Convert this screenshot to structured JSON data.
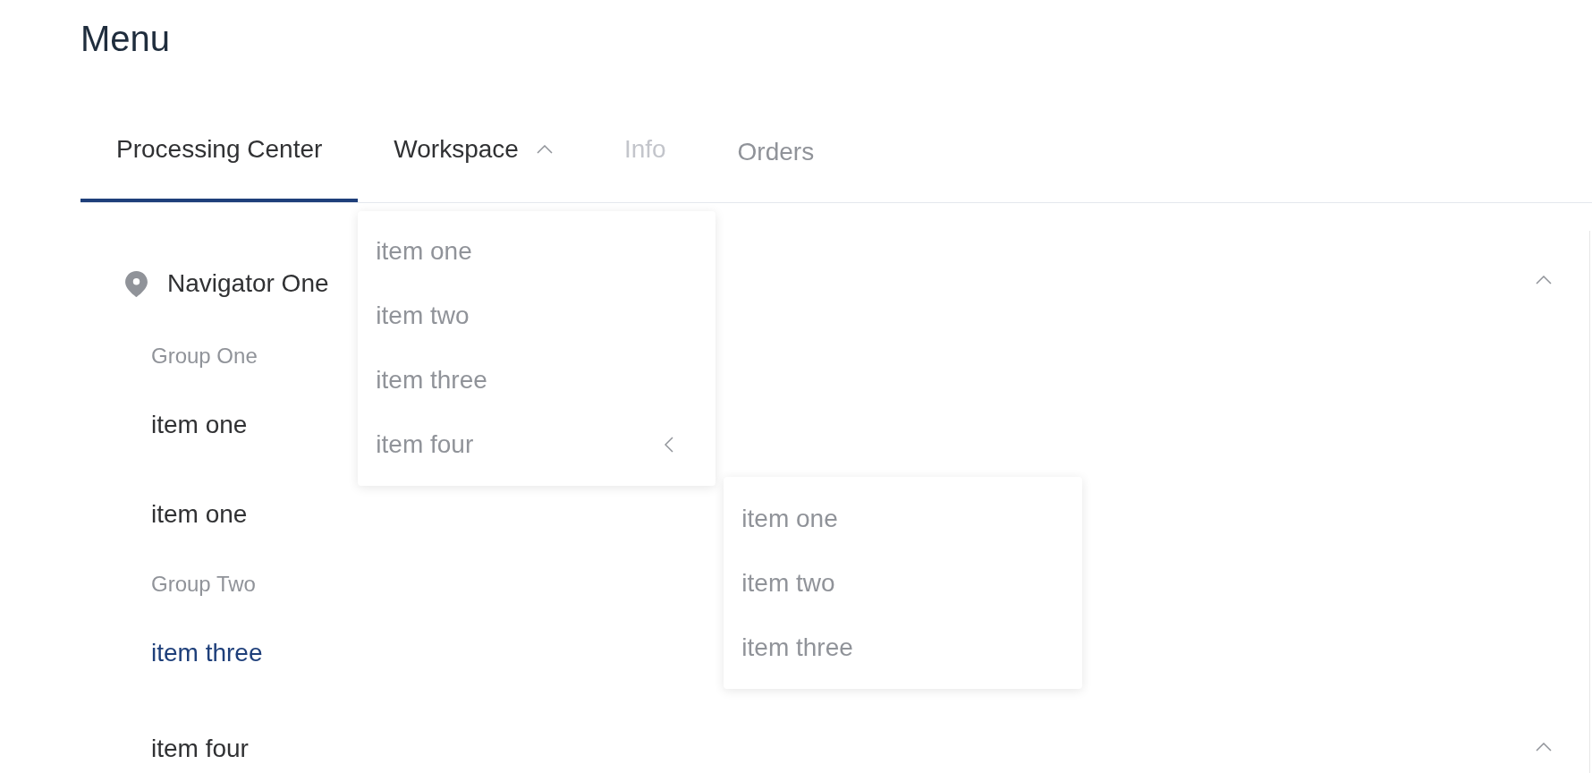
{
  "title": "Menu",
  "tabs": [
    {
      "kind": "item",
      "label": "Processing Center",
      "selected": true,
      "disabled": false
    },
    {
      "kind": "submenu",
      "label": "Workspace",
      "selected": false,
      "disabled": false,
      "expanded": true,
      "children": [
        {
          "kind": "item",
          "label": "item one",
          "selected": false
        },
        {
          "kind": "item",
          "label": "item two",
          "selected": false
        },
        {
          "kind": "item",
          "label": "item three",
          "selected": false
        },
        {
          "kind": "submenu",
          "label": "item four",
          "selected": false,
          "expanded": true,
          "children": [
            {
              "label": "item one",
              "selected": false
            },
            {
              "label": "item two",
              "selected": false
            },
            {
              "label": "item three",
              "selected": false
            }
          ]
        }
      ]
    },
    {
      "kind": "item",
      "label": "Info",
      "selected": false,
      "disabled": true
    },
    {
      "kind": "link",
      "label": "Orders",
      "selected": false,
      "disabled": false
    }
  ],
  "sidebar": {
    "items": [
      {
        "kind": "submenu",
        "label": "Navigator One",
        "expanded": true,
        "children": [
          {
            "kind": "group",
            "label": "Group One",
            "items": [
              {
                "label": "item one",
                "selected": false
              },
              {
                "label": "item one",
                "selected": false
              }
            ]
          },
          {
            "kind": "group",
            "label": "Group Two",
            "items": [
              {
                "label": "item three",
                "selected": true
              }
            ]
          },
          {
            "kind": "submenu",
            "label": "item four",
            "expanded": true
          }
        ]
      }
    ]
  }
}
